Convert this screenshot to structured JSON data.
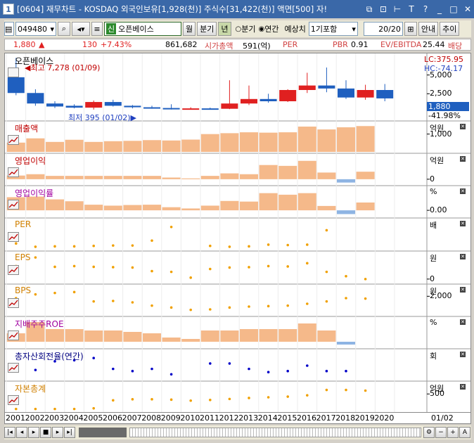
{
  "window": {
    "number": "1",
    "title": "[0604] 재무차트 - KOSDAQ 외국인보유[1,928(천)] 주식수[31,422(천)] 액면[500] 자!",
    "icons": [
      "restore-icon",
      "pin-icon",
      "marker-icon",
      "T",
      "help-icon",
      "minimize-icon",
      "maximize-icon",
      "close-icon"
    ]
  },
  "toolbar": {
    "code": "049480",
    "company_badge": "신",
    "company": "오픈베이스",
    "monthly": "월",
    "quarter": "분기",
    "year": "년",
    "radio_quarter": "분기",
    "radio_year": "연간",
    "estimate_label": "예상치",
    "estimate_value": "1기포함",
    "count": "20/20",
    "guide": "안내",
    "add": "추이"
  },
  "quote": {
    "price": "1,880",
    "change": "130",
    "pct": "+7.43%",
    "volume": "861,682",
    "cap_label": "시가총액",
    "cap": "591(억)",
    "per_label": "PER",
    "pbr_label": "PBR",
    "pbr": "0.91",
    "ev_label": "EV/EBITDA",
    "ev": "25.44",
    "div_label": "배당"
  },
  "years": [
    "2001",
    "2002",
    "2003",
    "2004",
    "2005",
    "2006",
    "2007",
    "2008",
    "2009",
    "2010",
    "2011",
    "2012",
    "2013",
    "2014",
    "2015",
    "2016",
    "2017",
    "2018",
    "2019",
    "2020"
  ],
  "date_right": "01/02",
  "panels": [
    {
      "title": "오픈베이스",
      "unit": "",
      "ticks": [
        "5,000",
        "2,500"
      ]
    },
    {
      "title": "매출액",
      "unit": "억원",
      "ticks": [
        "1,000"
      ]
    },
    {
      "title": "영업이익",
      "unit": "억원",
      "ticks": [
        "0"
      ]
    },
    {
      "title": "영업이익률",
      "unit": "%",
      "ticks": [
        "0.00"
      ]
    },
    {
      "title": "PER",
      "unit": "배",
      "ticks": []
    },
    {
      "title": "EPS",
      "unit": "원",
      "ticks": [
        "0"
      ]
    },
    {
      "title": "BPS",
      "unit": "원",
      "ticks": [
        "2,000"
      ]
    },
    {
      "title": "지배주주ROE",
      "unit": "%",
      "ticks": []
    },
    {
      "title": "총자산회전율(연간)",
      "unit": "회",
      "ticks": []
    },
    {
      "title": "자본총계",
      "unit": "억원",
      "ticks": [
        "500"
      ]
    }
  ],
  "price_panel": {
    "high_label": "최고 7,278 (01/09)",
    "low_label": "최저 395 (01/02)",
    "lc": "LC:375.95",
    "hc": "HC:-74.17",
    "current": "1,880",
    "current_pct": "-41.98%"
  },
  "colors": {
    "up": "#e02020",
    "down": "#1f5fbf",
    "bar": "#f5b98a",
    "neg": "#8eb4e3",
    "line_orange": "#f0a000",
    "line_blue": "#0000c8"
  },
  "chart_data": [
    {
      "type": "candlestick",
      "title": "오픈베이스",
      "x": [
        "2001",
        "2002",
        "2003",
        "2004",
        "2005",
        "2006",
        "2007",
        "2008",
        "2009",
        "2010",
        "2011",
        "2012",
        "2013",
        "2014",
        "2015",
        "2016",
        "2017",
        "2018",
        "2019",
        "2020"
      ],
      "series": [
        {
          "values": [
            [
              4700,
              7278,
              2300,
              2600
            ],
            [
              2600,
              3100,
              900,
              1200
            ],
            [
              1200,
              1500,
              600,
              800
            ],
            [
              900,
              1100,
              550,
              650
            ],
            [
              650,
              1600,
              395,
              1400
            ],
            [
              1400,
              1700,
              800,
              900
            ],
            [
              900,
              1000,
              550,
              700
            ],
            [
              700,
              900,
              500,
              600
            ],
            [
              600,
              1100,
              400,
              500
            ],
            [
              500,
              700,
              400,
              550
            ],
            [
              550,
              650,
              450,
              500
            ],
            [
              500,
              4300,
              450,
              1200
            ],
            [
              1200,
              3600,
              1000,
              1800
            ],
            [
              1800,
              2500,
              1300,
              1500
            ],
            [
              1500,
              3100,
              1400,
              3000
            ],
            [
              3000,
              5300,
              2600,
              3600
            ],
            [
              3600,
              6000,
              2700,
              3200
            ],
            [
              3200,
              4300,
              1800,
              2000
            ],
            [
              2000,
              3700,
              1700,
              3000
            ],
            [
              3000,
              3800,
              1500,
              1880
            ]
          ]
        }
      ],
      "ylim": [
        0,
        7500
      ]
    },
    {
      "type": "bar",
      "title": "매출액",
      "x": [
        "2001",
        "2002",
        "2003",
        "2004",
        "2005",
        "2006",
        "2007",
        "2008",
        "2009",
        "2010",
        "2011",
        "2012",
        "2013",
        "2014",
        "2015",
        "2016",
        "2017",
        "2018",
        "2019"
      ],
      "series": [
        {
          "name": "매출액",
          "values": [
            520,
            760,
            560,
            680,
            560,
            600,
            620,
            660,
            640,
            690,
            1000,
            1050,
            1100,
            1080,
            1100,
            1420,
            1260,
            1380,
            1450
          ]
        }
      ],
      "ylim": [
        0,
        1500
      ]
    },
    {
      "type": "bar",
      "title": "영업이익",
      "x": [
        "2001",
        "2002",
        "2003",
        "2004",
        "2005",
        "2006",
        "2007",
        "2008",
        "2009",
        "2010",
        "2011",
        "2012",
        "2013",
        "2014",
        "2015",
        "2016",
        "2017",
        "2018",
        "2019"
      ],
      "series": [
        {
          "name": "영업이익",
          "values": [
            22,
            30,
            20,
            20,
            20,
            20,
            20,
            20,
            10,
            5,
            20,
            35,
            30,
            85,
            80,
            110,
            40,
            -20,
            45
          ]
        }
      ],
      "ylim": [
        -30,
        130
      ]
    },
    {
      "type": "bar",
      "title": "영업이익률",
      "x": [
        "2001",
        "2002",
        "2003",
        "2004",
        "2005",
        "2006",
        "2007",
        "2008",
        "2009",
        "2010",
        "2011",
        "2012",
        "2013",
        "2014",
        "2015",
        "2016",
        "2017",
        "2018",
        "2019"
      ],
      "series": [
        {
          "name": "영업이익률",
          "values": [
            4.2,
            4.4,
            3.5,
            2.9,
            1.8,
            1.5,
            1.7,
            1.8,
            1.0,
            0.6,
            1.5,
            3.0,
            2.8,
            5.5,
            5.0,
            5.5,
            1.4,
            -1.2,
            2.5
          ]
        }
      ],
      "ylim": [
        -2,
        7
      ]
    },
    {
      "type": "line",
      "title": "PER",
      "x": [
        "2001",
        "2002",
        "2003",
        "2004",
        "2005",
        "2006",
        "2007",
        "2008",
        "2009",
        "2010",
        "2011",
        "2012",
        "2013",
        "2014",
        "2015",
        "2016",
        "2017"
      ],
      "series": [
        {
          "name": "PER",
          "values": [
            15,
            7,
            8,
            8,
            9,
            10,
            10,
            22,
            55,
            null,
            9,
            7,
            8,
            12,
            11,
            12,
            47
          ]
        }
      ],
      "ylim": [
        0,
        70
      ]
    },
    {
      "type": "line",
      "title": "EPS",
      "x": [
        "2001",
        "2002",
        "2003",
        "2004",
        "2005",
        "2006",
        "2007",
        "2008",
        "2009",
        "2010",
        "2011",
        "2012",
        "2013",
        "2014",
        "2015",
        "2016",
        "2017",
        "2018",
        "2019"
      ],
      "series": [
        {
          "name": "EPS",
          "values": [
            180,
            300,
            170,
            180,
            170,
            165,
            160,
            110,
            100,
            20,
            140,
            160,
            165,
            180,
            175,
            220,
            100,
            40,
            0
          ]
        }
      ],
      "ylim": [
        -50,
        350
      ]
    },
    {
      "type": "line",
      "title": "BPS",
      "x": [
        "2001",
        "2002",
        "2003",
        "2004",
        "2005",
        "2006",
        "2007",
        "2008",
        "2009",
        "2010",
        "2011",
        "2012",
        "2013",
        "2014",
        "2015",
        "2016",
        "2017",
        "2018",
        "2019"
      ],
      "series": [
        {
          "name": "BPS",
          "values": [
            1800,
            2200,
            2350,
            2450,
            1450,
            1500,
            1350,
            1000,
            800,
            550,
            600,
            800,
            900,
            950,
            1000,
            1200,
            1450,
            1800,
            1750
          ]
        }
      ],
      "ylim": [
        0,
        3000
      ]
    },
    {
      "type": "bar",
      "title": "지배주주ROE",
      "x": [
        "2001",
        "2002",
        "2003",
        "2004",
        "2005",
        "2006",
        "2007",
        "2008",
        "2009",
        "2010",
        "2011",
        "2012",
        "2013",
        "2014",
        "2015",
        "2016",
        "2017",
        "2018"
      ],
      "series": [
        {
          "name": "지배주주ROE",
          "values": [
            6,
            14,
            9,
            9,
            8,
            8,
            7,
            6,
            3,
            2,
            8,
            8,
            9,
            9,
            9,
            13,
            8,
            -2
          ]
        }
      ],
      "ylim": [
        -4,
        16
      ]
    },
    {
      "type": "line",
      "title": "총자산회전율(연간)",
      "x": [
        "2001",
        "2002",
        "2003",
        "2004",
        "2005",
        "2006",
        "2007",
        "2008",
        "2009",
        "2010",
        "2011",
        "2012",
        "2013",
        "2014",
        "2015",
        "2016",
        "2017",
        "2018"
      ],
      "series": [
        {
          "name": "총자산회전율(연간)",
          "values": [
            0.9,
            0.95,
            1.35,
            1.4,
            1.5,
            1.0,
            0.9,
            1.0,
            0.75,
            null,
            1.25,
            1.25,
            1.0,
            0.85,
            0.9,
            1.15,
            0.9,
            0.9
          ]
        }
      ],
      "ylim": [
        0.5,
        1.8
      ]
    },
    {
      "type": "line",
      "title": "자본총계",
      "x": [
        "2001",
        "2002",
        "2003",
        "2004",
        "2005",
        "2006",
        "2007",
        "2008",
        "2009",
        "2010",
        "2011",
        "2012",
        "2013",
        "2014",
        "2015",
        "2016",
        "2017",
        "2018",
        "2019"
      ],
      "series": [
        {
          "name": "자본총계",
          "values": [
            50,
            50,
            50,
            50,
            70,
            310,
            340,
            340,
            330,
            300,
            320,
            350,
            380,
            400,
            420,
            460,
            620,
            620,
            600
          ]
        }
      ],
      "ylim": [
        0,
        800
      ]
    }
  ]
}
